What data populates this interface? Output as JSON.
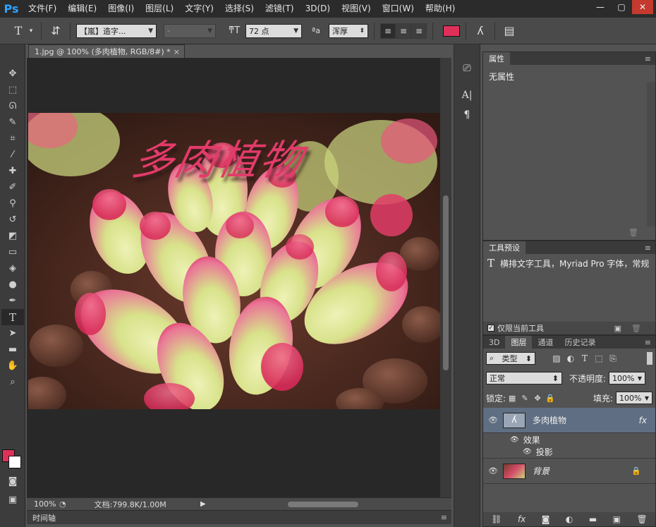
{
  "app": {
    "logo": "Ps"
  },
  "menu": [
    "文件(F)",
    "编辑(E)",
    "图像(I)",
    "图层(L)",
    "文字(Y)",
    "选择(S)",
    "滤镜(T)",
    "3D(D)",
    "视图(V)",
    "窗口(W)",
    "帮助(H)"
  ],
  "options": {
    "tool_glyph": "T",
    "font_family": "【嵐】造字...",
    "font_style": "-",
    "font_size": "72 点",
    "aa_label": "ªa",
    "antialias": "浑厚",
    "text_color": "#e0305a"
  },
  "document": {
    "tab_title": "1.jpg @ 100% (多肉植物, RGB/8#) *",
    "image_text": "多肉植物",
    "zoom": "100%",
    "doc_size": "文档:799.8K/1.00M"
  },
  "timeline": {
    "label": "时间轴"
  },
  "properties": {
    "tab": "属性",
    "empty_text": "无属性"
  },
  "tool_presets": {
    "tab": "工具预设",
    "preset_text": "横排文字工具，Myriad Pro 字体，常规",
    "current_only": "仅限当前工具"
  },
  "layers": {
    "tabs": [
      "3D",
      "图层",
      "通道",
      "历史记录"
    ],
    "filter_type": "类型",
    "blend_mode": "正常",
    "opacity_label": "不透明度:",
    "opacity": "100%",
    "lock_label": "锁定:",
    "fill_label": "填充:",
    "fill": "100%",
    "items": [
      {
        "name": "多肉植物",
        "fx": "fx",
        "effects_label": "效果",
        "effect": "投影"
      },
      {
        "name": "背景"
      }
    ]
  },
  "colors": {
    "foreground": "#e0305a",
    "background": "#ffffff",
    "selection": "#5f6e82"
  }
}
